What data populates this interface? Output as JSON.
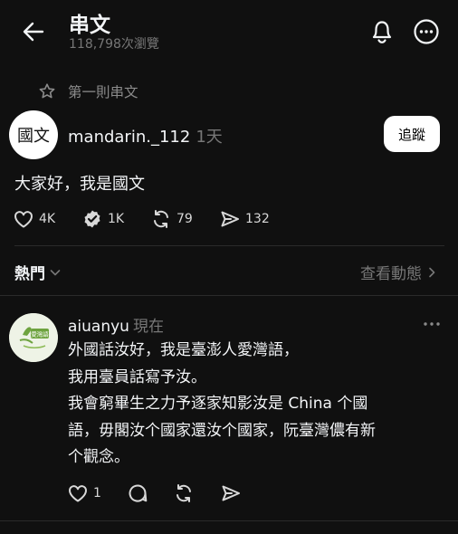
{
  "header": {
    "title": "串文",
    "views": "118,798次瀏覽"
  },
  "first_thread_label": "第一則串文",
  "post": {
    "avatar_text": "國文",
    "username": "mandarin._112",
    "timestamp": "1天",
    "follow_label": "追蹤",
    "text": "大家好，我是國文",
    "likes": "4K",
    "reposts_approved": "1K",
    "reposts": "79",
    "shares": "132"
  },
  "sort": {
    "label": "熱門",
    "view_activity": "查看動態"
  },
  "reply": {
    "username": "aiuanyu",
    "timestamp": "現在",
    "avatar_text": "愛灣語",
    "lines": [
      "外國話汝好，我是臺澎人愛灣語，",
      "我用臺員話寫予汝。",
      "我會窮畢生之力予逐家知影汝是 China 个國",
      "語，毋閣汝个國家還汝个國家，阮臺灣儂有新",
      "个觀念。"
    ],
    "likes": "1"
  }
}
